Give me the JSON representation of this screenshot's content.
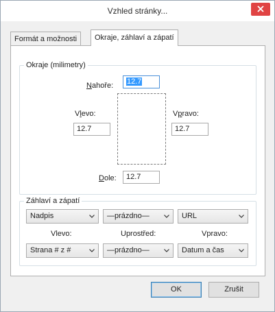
{
  "window": {
    "title": "Vzhled stránky..."
  },
  "tabs": [
    {
      "label": "Formát a možnosti",
      "active": false
    },
    {
      "label": "Okraje, záhlaví a zápatí",
      "active": true
    }
  ],
  "margins": {
    "group_label": "Okraje (milimetry)",
    "top": {
      "label_underline": "N",
      "label_rest": "ahoře:",
      "value": "12.7"
    },
    "left": {
      "label_pre": "V",
      "label_underline": "l",
      "label_rest": "evo:",
      "value": "12.7"
    },
    "right": {
      "label_pre": "V",
      "label_underline": "p",
      "label_rest": "ravo:",
      "value": "12.7"
    },
    "bottom": {
      "label_underline": "D",
      "label_rest": "ole:",
      "value": "12.7"
    }
  },
  "header_footer": {
    "group_label": "Záhlaví a zápatí",
    "header": {
      "left": "Nadpis",
      "center": "—prázdno—",
      "right": "URL"
    },
    "column_labels": {
      "left": "Vlevo:",
      "center": "Uprostřed:",
      "right": "Vpravo:"
    },
    "footer": {
      "left": "Strana # z #",
      "center": "—prázdno—",
      "right": "Datum a čas"
    }
  },
  "buttons": {
    "ok": "OK",
    "cancel": "Zrušit"
  },
  "icons": {
    "close": "close-icon",
    "dropdown": "chevron-down-icon"
  },
  "colors": {
    "close_bg": "#e04343",
    "selection": "#3399ff",
    "default_button_border": "#3c7fb1"
  }
}
